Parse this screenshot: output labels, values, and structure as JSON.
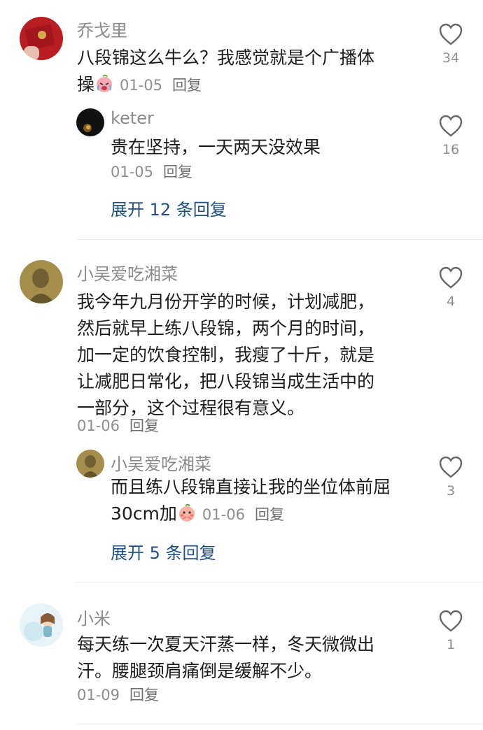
{
  "comments": [
    {
      "username": "乔戈里",
      "text_lines": [
        "八段锦这么牛么？我感觉就是个广播体",
        "操"
      ],
      "emoji": "crying-emoji",
      "date": "01-05",
      "reply_label": "回复",
      "likes": "34",
      "replies": [
        {
          "username": "keter",
          "text": "贵在坚持，一天两天没效果",
          "date": "01-05",
          "reply_label": "回复",
          "likes": "16"
        }
      ],
      "expand_label": "展开 12 条回复"
    },
    {
      "username": "小吴爱吃湘菜",
      "text_lines": [
        "我今年九月份开学的时候，计划减肥，",
        "然后就早上练八段锦，两个月的时间，",
        "加一定的饮食控制，我瘦了十斤，就是",
        "让减肥日常化，把八段锦当成生活中的",
        "一部分，这个过程很有意义。"
      ],
      "date": "01-06",
      "reply_label": "回复",
      "likes": "4",
      "replies": [
        {
          "username": "小吴爱吃湘菜",
          "text_lines": [
            "而且练八段锦直接让我的坐位体前屈",
            "30cm加"
          ],
          "emoji": "shy-emoji",
          "date": "01-06",
          "reply_label": "回复",
          "likes": "3"
        }
      ],
      "expand_label": "展开 5 条回复"
    },
    {
      "username": "小米",
      "text_lines": [
        "每天练一次夏天汗蒸一样，冬天微微出",
        "汗。腰腿颈肩痛倒是缓解不少。"
      ],
      "date": "01-09",
      "reply_label": "回复",
      "likes": "1"
    }
  ],
  "icons": {
    "like": "heart-outline-icon"
  },
  "colors": {
    "expand_link": "#1f4f87",
    "meta": "#8e8e8e"
  }
}
